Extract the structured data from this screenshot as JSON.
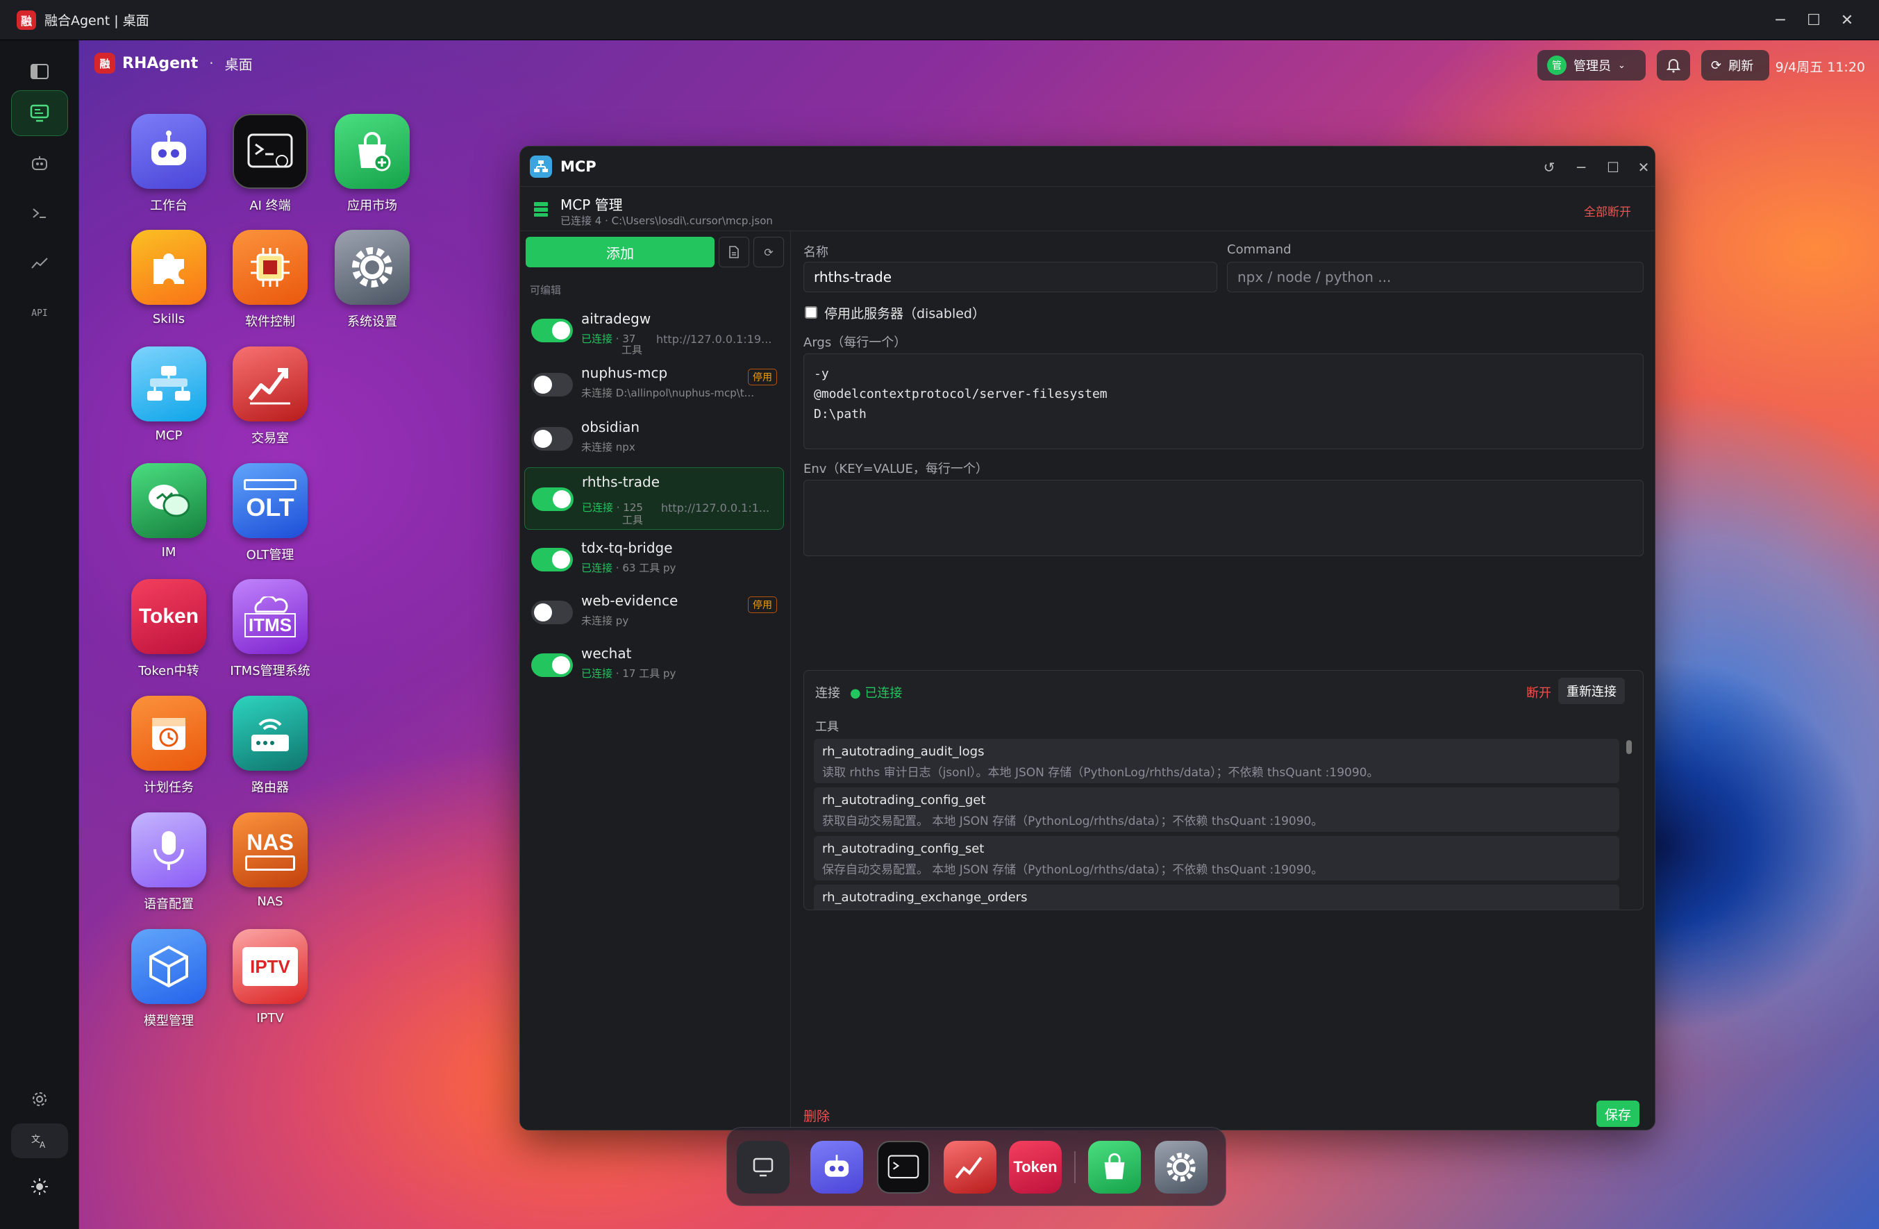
{
  "window": {
    "title": "融合Agent | 桌面",
    "logo_text": "融"
  },
  "sidebar": {
    "items": [
      "桌面",
      "智能体",
      "终端",
      "交易",
      "API"
    ],
    "api_label": "API",
    "bottom": [
      "设置",
      "语言",
      "主题"
    ]
  },
  "topbar": {
    "brand": "RHAgent",
    "sep": "·",
    "crumb": "桌面",
    "user": "管理员",
    "user_avatar": "管",
    "refresh": "刷新",
    "datetime": "9/4周五 11:20"
  },
  "apps": [
    {
      "label": "工作台",
      "icon": "robot-icon",
      "color": "#5a5cf0"
    },
    {
      "label": "AI 终端",
      "icon": "terminal-icon",
      "color": "#111"
    },
    {
      "label": "应用市场",
      "icon": "shopping-bag-icon",
      "color": "#22c55e"
    },
    {
      "label": "Skills",
      "icon": "puzzle-icon",
      "color": "#f59e0b"
    },
    {
      "label": "软件控制",
      "icon": "chip-icon",
      "color": "#f97316"
    },
    {
      "label": "系统设置",
      "icon": "gear-icon",
      "color": "#6b7280"
    },
    {
      "label": "MCP",
      "icon": "network-icon",
      "color": "#38bdf8"
    },
    {
      "label": "交易室",
      "icon": "trend-chart-icon",
      "color": "#dc2626"
    },
    {
      "label": "IM",
      "icon": "chat-bubbles-icon",
      "color": "#22a55e"
    },
    {
      "label": "OLT管理",
      "icon": "olt-icon",
      "color": "#2563eb"
    },
    {
      "label": "Token中转",
      "icon": "token-icon",
      "color": "#e11d48"
    },
    {
      "label": "ITMS管理系统",
      "icon": "itms-cloud-icon",
      "color": "#a855f7"
    },
    {
      "label": "计划任务",
      "icon": "calendar-clock-icon",
      "color": "#f97316"
    },
    {
      "label": "路由器",
      "icon": "router-icon",
      "color": "#14b8a6"
    },
    {
      "label": "语音配置",
      "icon": "microphone-icon",
      "color": "#a78bfa"
    },
    {
      "label": "NAS",
      "icon": "nas-icon",
      "color": "#f97316"
    },
    {
      "label": "模型管理",
      "icon": "cube-icon",
      "color": "#3b82f6"
    },
    {
      "label": "IPTV",
      "icon": "tv-icon",
      "color": "#ef4444"
    }
  ],
  "app_text": {
    "token": "Token",
    "olt": "OLT",
    "itms": "ITMS",
    "nas": "NAS",
    "iptv": "IPTV"
  },
  "mcp": {
    "title": "MCP",
    "manage_title": "MCP 管理",
    "manage_sub": "已连接 4 · C:\\Users\\losdi\\.cursor\\mcp.json",
    "disconnect_all": "全部断开",
    "add": "添加",
    "editable": "可编辑",
    "servers": [
      {
        "name": "aitradegw",
        "on": true,
        "status": "已连接",
        "meta": "· 37",
        "meta2": "工具",
        "url": "http://127.0.0.1:19..."
      },
      {
        "name": "nuphus-mcp",
        "on": false,
        "status": "未连接",
        "meta": "D:\\allinpol\\nuphus-mcp\\t...",
        "badge": "停用"
      },
      {
        "name": "obsidian",
        "on": false,
        "status": "未连接",
        "meta": "npx"
      },
      {
        "name": "rhths-trade",
        "on": true,
        "status": "已连接",
        "meta": "· 125",
        "meta2": "工具",
        "url": "http://127.0.0.1:1...",
        "selected": true
      },
      {
        "name": "tdx-tq-bridge",
        "on": true,
        "status": "已连接",
        "meta": "· 63 工具 py"
      },
      {
        "name": "web-evidence",
        "on": false,
        "status": "未连接",
        "meta": "py",
        "badge": "停用"
      },
      {
        "name": "wechat",
        "on": true,
        "status": "已连接",
        "meta": "· 17 工具 py"
      }
    ],
    "form": {
      "name_label": "名称",
      "name_value": "rhths-trade",
      "command_label": "Command",
      "command_placeholder": "npx / node / python ...",
      "disable_label": "停用此服务器（disabled）",
      "args_label": "Args（每行一个）",
      "args_value": "-y\n@modelcontextprotocol/server-filesystem\nD:\\path",
      "env_label": "Env（KEY=VALUE，每行一个）"
    },
    "connection": {
      "label": "连接",
      "status": "● 已连接",
      "disconnect": "断开",
      "reconnect": "重新连接",
      "tools_label": "工具",
      "tools": [
        {
          "name": "rh_autotrading_audit_logs",
          "desc": "读取 rhths 审计日志（jsonl）。本地 JSON 存储（PythonLog/rhths/data）；不依赖 thsQuant :19090。"
        },
        {
          "name": "rh_autotrading_config_get",
          "desc": "获取自动交易配置。 本地 JSON 存储（PythonLog/rhths/data）；不依赖 thsQuant :19090。"
        },
        {
          "name": "rh_autotrading_config_set",
          "desc": "保存自动交易配置。 本地 JSON 存储（PythonLog/rhths/data）；不依赖 thsQuant :19090。"
        },
        {
          "name": "rh_autotrading_exchange_orders",
          "desc": ""
        }
      ]
    },
    "delete": "删除",
    "save": "保存"
  },
  "dock": {
    "token": "Token"
  }
}
